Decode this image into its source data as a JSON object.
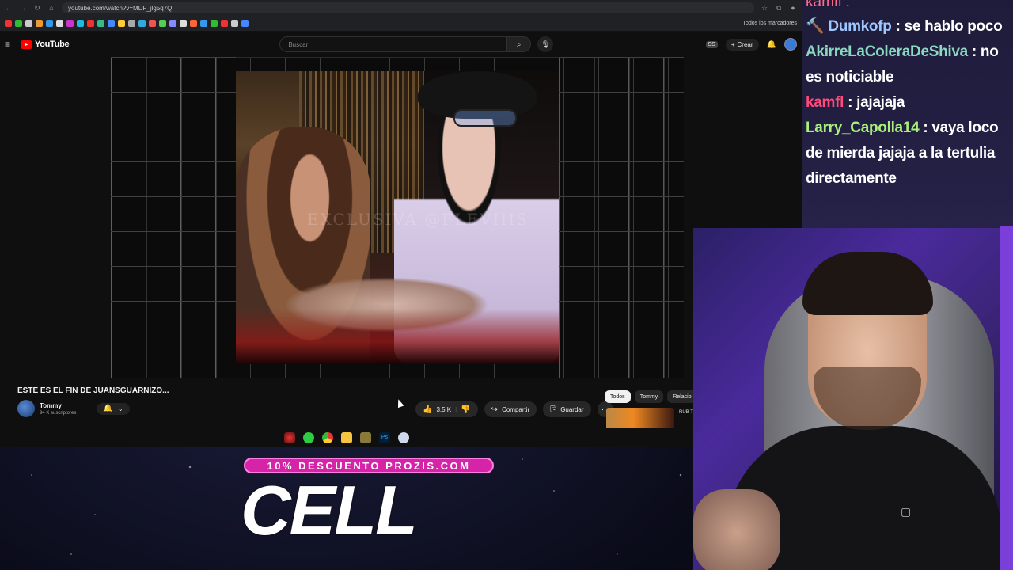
{
  "browser": {
    "url": "youtube.com/watch?v=MDF_jlg5q7Q",
    "bookmarks_folder": "Todos los marcadores"
  },
  "youtube": {
    "logo_text": "YouTube",
    "search_placeholder": "Buscar",
    "create_label": "Crear",
    "video": {
      "title": "ESTE ES EL FIN DE JUANSGUARNIZO...",
      "watermark": "EXCLUSIVA @FLEVIIIS",
      "channel_name": "Tommy",
      "subscribers": "94 K suscriptores",
      "likes": "3,5 K",
      "share_label": "Compartir",
      "save_label": "Guardar"
    },
    "chips": [
      "Todos",
      "Tommy",
      "Relacio"
    ],
    "rec_thumb_text": "RUB TERI"
  },
  "chat": {
    "top_partial": "kamfl :",
    "messages": [
      {
        "user": "Dumkofp",
        "color": "#9ec6ff",
        "text": "se hablo poco"
      },
      {
        "user": "AkirreLaColeraDeShiva",
        "color": "#8ad8c0",
        "text": "no es noticiable"
      },
      {
        "user": "kamfl",
        "color": "#ff4a7a",
        "text": "jajajaja"
      },
      {
        "user": "Larry_Capolla14",
        "color": "#a8f07a",
        "text": "vaya loco de mierda jajaja a la tertulia directamente"
      }
    ]
  },
  "promo": {
    "banner": "10% DESCUENTO PROZIS.COM",
    "code": "CELL"
  }
}
